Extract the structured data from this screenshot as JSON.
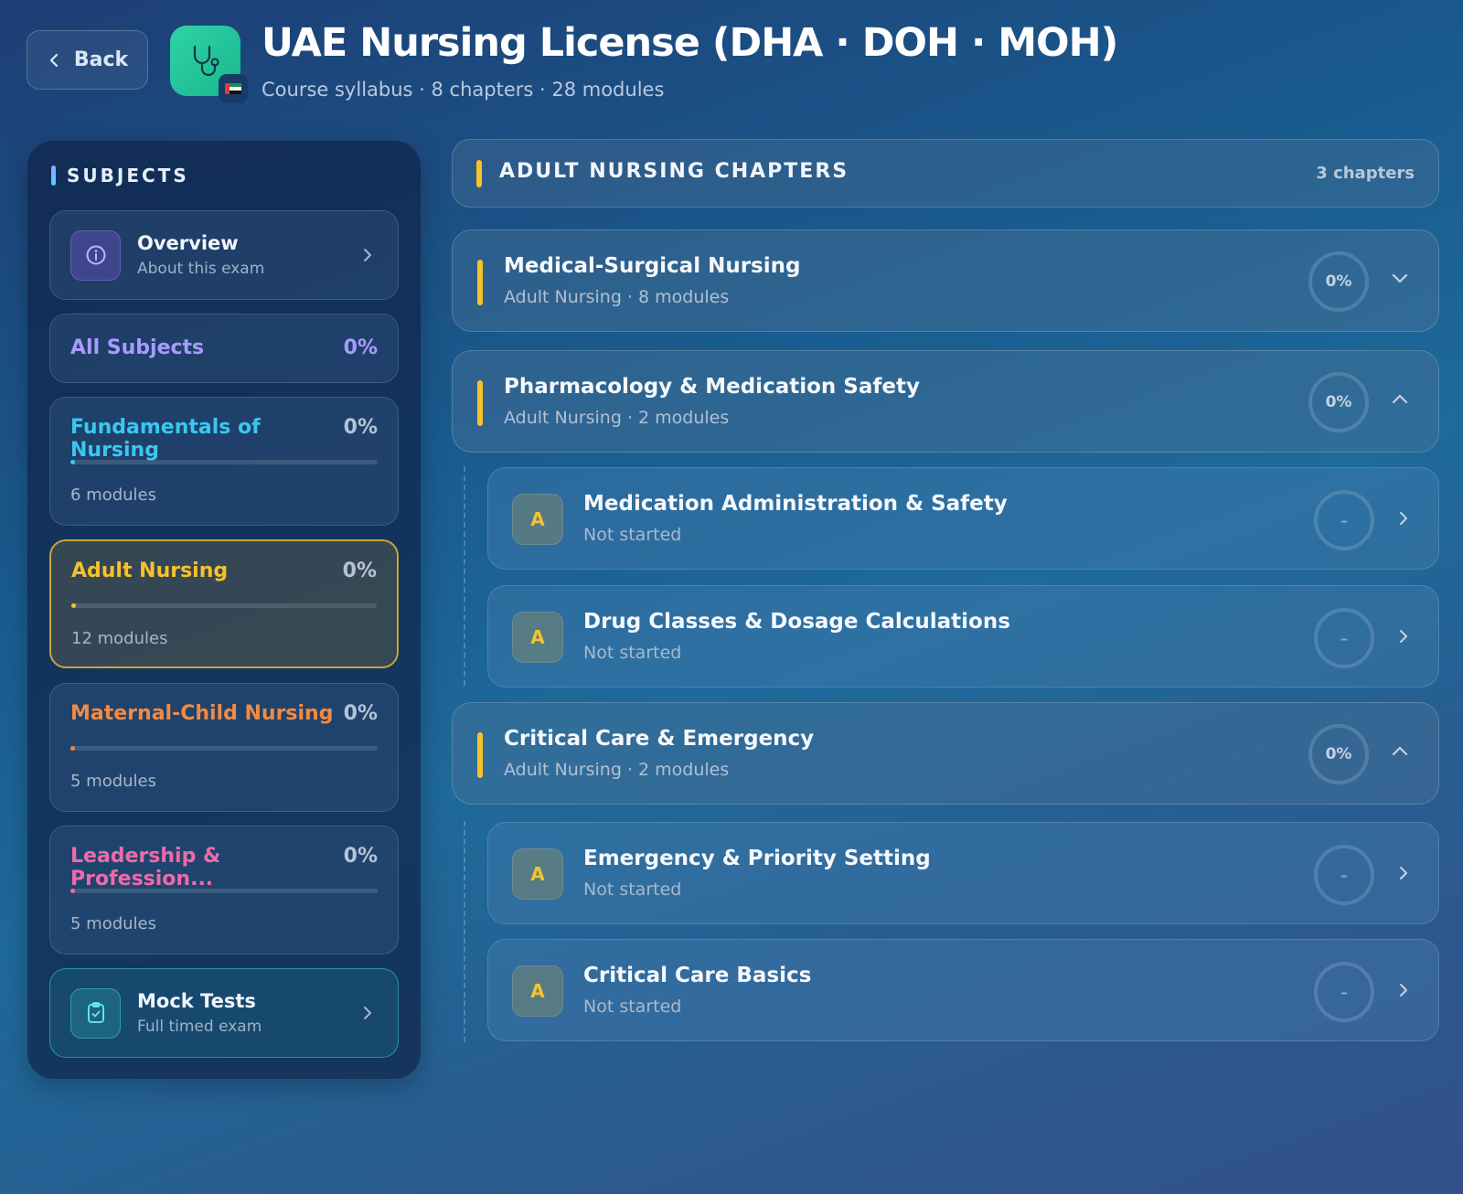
{
  "header": {
    "back_label": "Back",
    "title": "UAE Nursing License (DHA · DOH · MOH)",
    "subtitle": "Course syllabus · 8 chapters · 28 modules"
  },
  "sidebar": {
    "heading": "SUBJECTS",
    "overview": {
      "title": "Overview",
      "subtitle": "About this exam"
    },
    "all_subjects": {
      "label": "All Subjects",
      "percent": "0%"
    },
    "subjects": [
      {
        "name": "Fundamentals of Nursing",
        "percent": "0%",
        "modules": "6 modules",
        "color": "#39c8ef"
      },
      {
        "name": "Adult Nursing",
        "percent": "0%",
        "modules": "12 modules",
        "color": "#f6c22b"
      },
      {
        "name": "Maternal-Child Nursing",
        "percent": "0%",
        "modules": "5 modules",
        "color": "#f28a42"
      },
      {
        "name": "Leadership & Profession...",
        "percent": "0%",
        "modules": "5 modules",
        "color": "#ee6aa8"
      }
    ],
    "mock_tests": {
      "title": "Mock Tests",
      "subtitle": "Full timed exam"
    }
  },
  "main": {
    "section_title": "ADULT NURSING CHAPTERS",
    "section_count": "3 chapters",
    "chapters": [
      {
        "title": "Medical-Surgical Nursing",
        "meta": "Adult Nursing · 8 modules",
        "percent": "0%",
        "expanded": false,
        "modules": []
      },
      {
        "title": "Pharmacology & Medication Safety",
        "meta": "Adult Nursing · 2 modules",
        "percent": "0%",
        "expanded": true,
        "modules": [
          {
            "badge": "A",
            "title": "Medication Administration & Safety",
            "status": "Not started",
            "progress": "–"
          },
          {
            "badge": "A",
            "title": "Drug Classes & Dosage Calculations",
            "status": "Not started",
            "progress": "–"
          }
        ]
      },
      {
        "title": "Critical Care & Emergency",
        "meta": "Adult Nursing · 2 modules",
        "percent": "0%",
        "expanded": true,
        "modules": [
          {
            "badge": "A",
            "title": "Emergency & Priority Setting",
            "status": "Not started",
            "progress": "–"
          },
          {
            "badge": "A",
            "title": "Critical Care Basics",
            "status": "Not started",
            "progress": "–"
          }
        ]
      }
    ]
  },
  "colors": {
    "accent_yellow": "#f6c22b",
    "all_subjects": "#a99bff",
    "app_icon": "#2fd3a6"
  },
  "icons": [
    "chevron-left-icon",
    "stethoscope-icon",
    "uae-flag-icon",
    "info-icon",
    "chevron-right-icon",
    "clipboard-check-icon",
    "chevron-down-icon",
    "chevron-up-icon"
  ]
}
